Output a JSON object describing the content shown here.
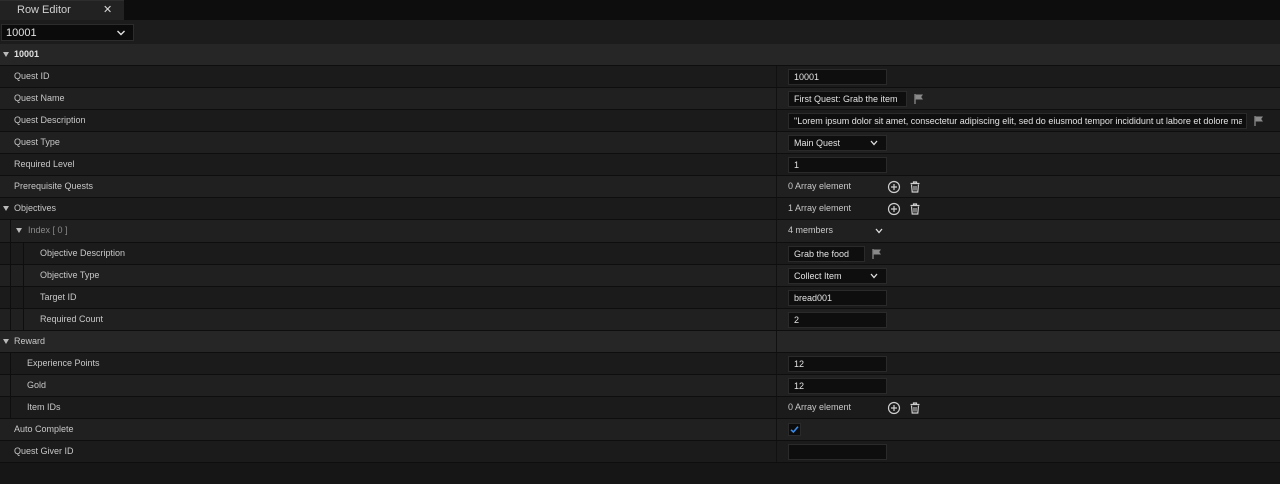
{
  "tab": {
    "title": "Row Editor",
    "close_glyph": "✕"
  },
  "row_selector": {
    "value": "10001"
  },
  "row_header": {
    "label": "10001"
  },
  "fields": {
    "quest_id": {
      "label": "Quest ID",
      "value": "10001"
    },
    "quest_name": {
      "label": "Quest Name",
      "value": "First Quest: Grab the item"
    },
    "quest_description": {
      "label": "Quest Description",
      "value": "\"Lorem ipsum dolor sit amet, consectetur adipiscing elit, sed do eiusmod tempor incididunt ut labore et dolore magna aliqua.\""
    },
    "quest_type": {
      "label": "Quest Type",
      "value": "Main Quest"
    },
    "required_level": {
      "label": "Required Level",
      "value": "1"
    },
    "prerequisite_quests": {
      "label": "Prerequisite Quests",
      "value": "0 Array element"
    },
    "objectives": {
      "label": "Objectives",
      "value": "1 Array element"
    },
    "objective_index": {
      "label": "Index [ 0 ]",
      "value": "4 members"
    },
    "objective_description": {
      "label": "Objective Description",
      "value": "Grab the food"
    },
    "objective_type": {
      "label": "Objective Type",
      "value": "Collect Item"
    },
    "target_id": {
      "label": "Target ID",
      "value": "bread001"
    },
    "required_count": {
      "label": "Required Count",
      "value": "2"
    },
    "reward": {
      "label": "Reward"
    },
    "experience_points": {
      "label": "Experience Points",
      "value": "12"
    },
    "gold": {
      "label": "Gold",
      "value": "12"
    },
    "item_ids": {
      "label": "Item IDs",
      "value": "0 Array element"
    },
    "auto_complete": {
      "label": "Auto Complete",
      "checked": true
    },
    "quest_giver_id": {
      "label": "Quest Giver ID",
      "value": ""
    }
  },
  "icons": {
    "add": "add-circle-icon",
    "delete": "trash-icon",
    "flag": "flag-icon",
    "expand": "caret-down-icon",
    "dropdown": "chevron-down-icon",
    "check": "checkmark-icon"
  },
  "colors": {
    "check_accent": "#2f7fd8",
    "panel_bg": "#161616",
    "header_bg": "#262626"
  }
}
